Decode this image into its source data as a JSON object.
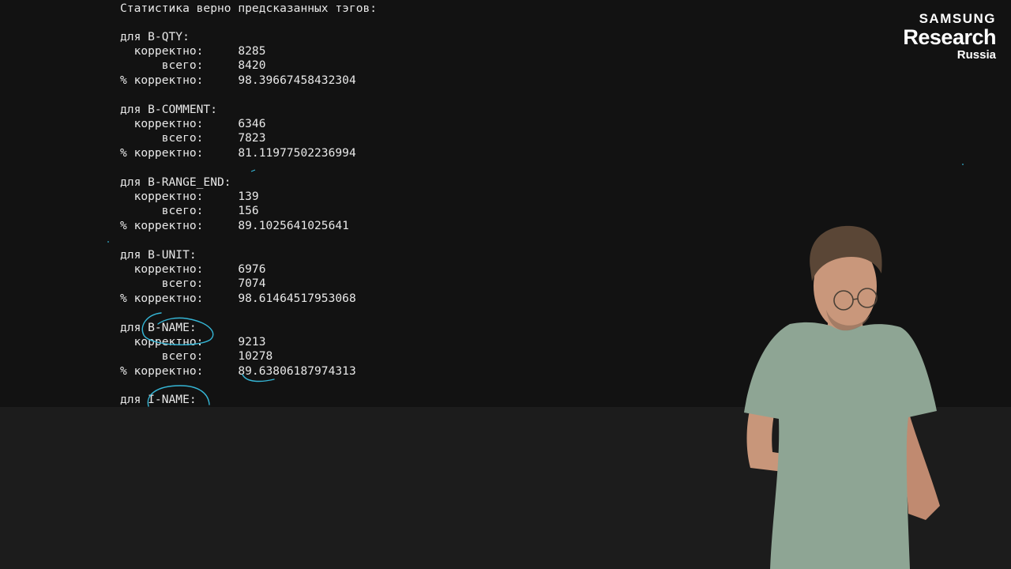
{
  "console": {
    "lines": [
      "Статистика верно предсказанных тэгов:",
      "",
      "для B-QTY:",
      "  корректно:     8285",
      "      всего:     8420",
      "% корректно:     98.39667458432304",
      "",
      "для B-COMMENT:",
      "  корректно:     6346",
      "      всего:     7823",
      "% корректно:     81.11977502236994",
      "",
      "для B-RANGE_END:",
      "  корректно:     139",
      "      всего:     156",
      "% корректно:     89.1025641025641",
      "",
      "для B-UNIT:",
      "  корректно:     6976",
      "      всего:     7074",
      "% корректно:     98.61464517953068",
      "",
      "для B-NAME:",
      "  корректно:     9213",
      "      всего:     10278",
      "% корректно:     89.63806187974313",
      "",
      "для I-NAME:"
    ]
  },
  "logo": {
    "brand": "SAMSUNG",
    "product": "Research",
    "region": "Russia"
  },
  "colors": {
    "background_top": "#121212",
    "background_bottom": "#1c1c1c",
    "text": "#e8e8e8",
    "annotation": "#35b6d6"
  }
}
